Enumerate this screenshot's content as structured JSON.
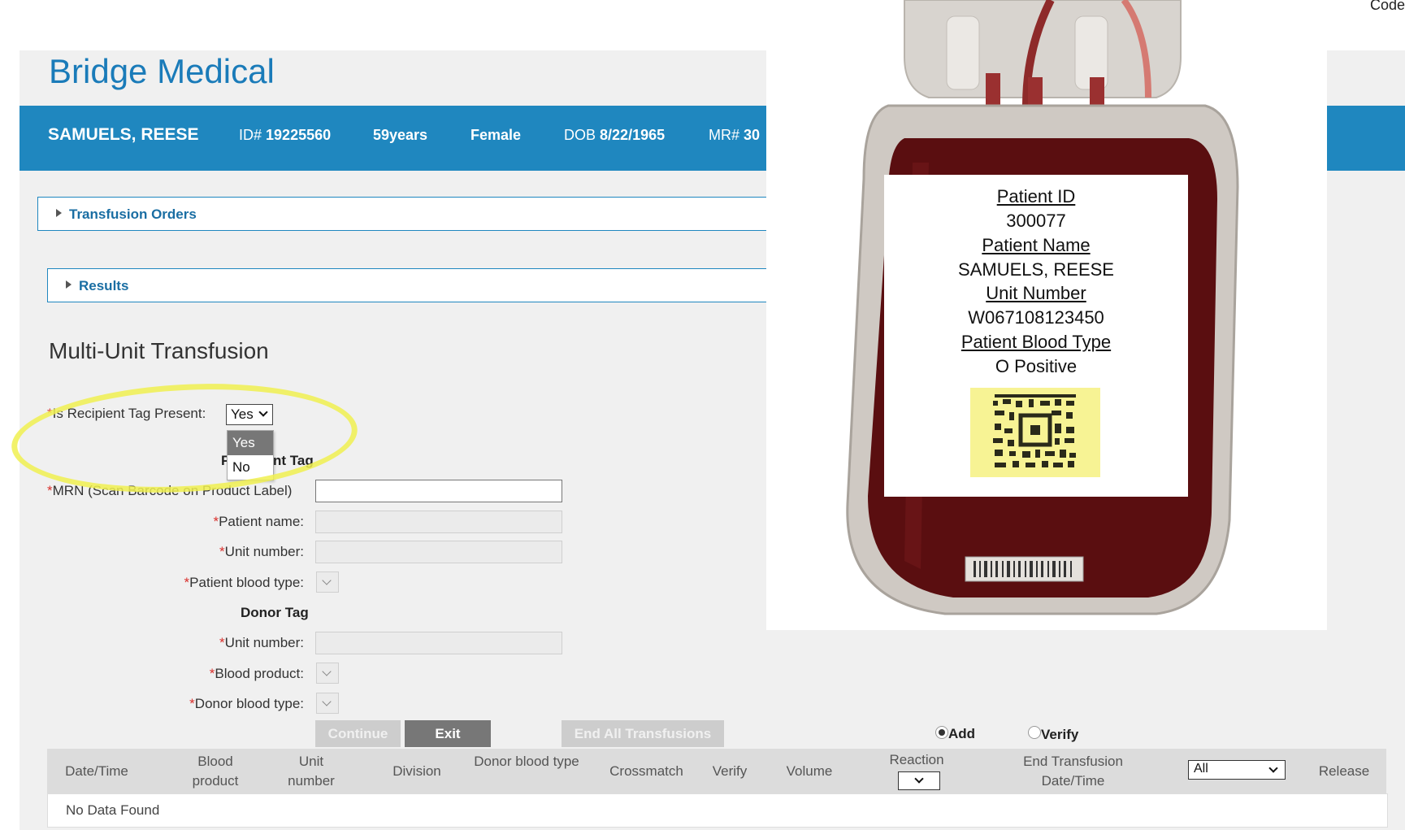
{
  "corner_text": "Code",
  "brand": {
    "bold": "Bridge",
    "light": "Medical"
  },
  "patient": {
    "name": "SAMUELS, REESE",
    "id_label": "ID#",
    "id": "19225560",
    "age": "59years",
    "sex": "Female",
    "dob_label": "DOB",
    "dob": "8/22/1965",
    "mr_label": "MR#",
    "mr": "30"
  },
  "accordions": {
    "orders": "Transfusion Orders",
    "results": "Results"
  },
  "section_title": "Multi-Unit Transfusion",
  "form": {
    "recipient_tag_question": "Is Recipient Tag Present:",
    "recipient_tag_value": "Yes",
    "dropdown_options": [
      "Yes",
      "No"
    ],
    "patient_tag_heading_partial_left": "P",
    "patient_tag_heading_partial_right": "nt Tag",
    "mrn_label": "MRN (Scan Barcode on Product Label)",
    "patient_name_label": "Patient name:",
    "unit_number_label": "Unit number:",
    "patient_blood_type_label": "Patient blood type:",
    "donor_tag_heading": "Donor Tag",
    "donor_unit_number_label": "Unit number:",
    "blood_product_label": "Blood product:",
    "donor_blood_type_label": "Donor blood type:",
    "required_mark": "*"
  },
  "buttons": {
    "continue": "Continue",
    "exit": "Exit",
    "end_all": "End All Transfusions"
  },
  "radios": {
    "add": "Add",
    "verify": "Verify",
    "selected": "Add"
  },
  "table": {
    "columns": [
      "Date/Time",
      "Blood product",
      "Unit number",
      "Division",
      "Donor blood type",
      "Crossmatch",
      "Verify",
      "Volume",
      "Reaction",
      "End Transfusion Date/Time",
      "All",
      "Release"
    ],
    "empty_text": "No Data Found"
  },
  "photo_label": {
    "patient_id_heading": "Patient ID",
    "patient_id": "300077",
    "patient_name_heading": "Patient Name",
    "patient_name": "SAMUELS, REESE",
    "unit_number_heading": "Unit Number",
    "unit_number": "W067108123450",
    "blood_type_heading": "Patient Blood Type",
    "blood_type": "O Positive"
  },
  "colors": {
    "brand": "#1a7bb9",
    "header_bar": "#1f87bf",
    "required": "#d9302c",
    "highlight": "#f0f050"
  }
}
